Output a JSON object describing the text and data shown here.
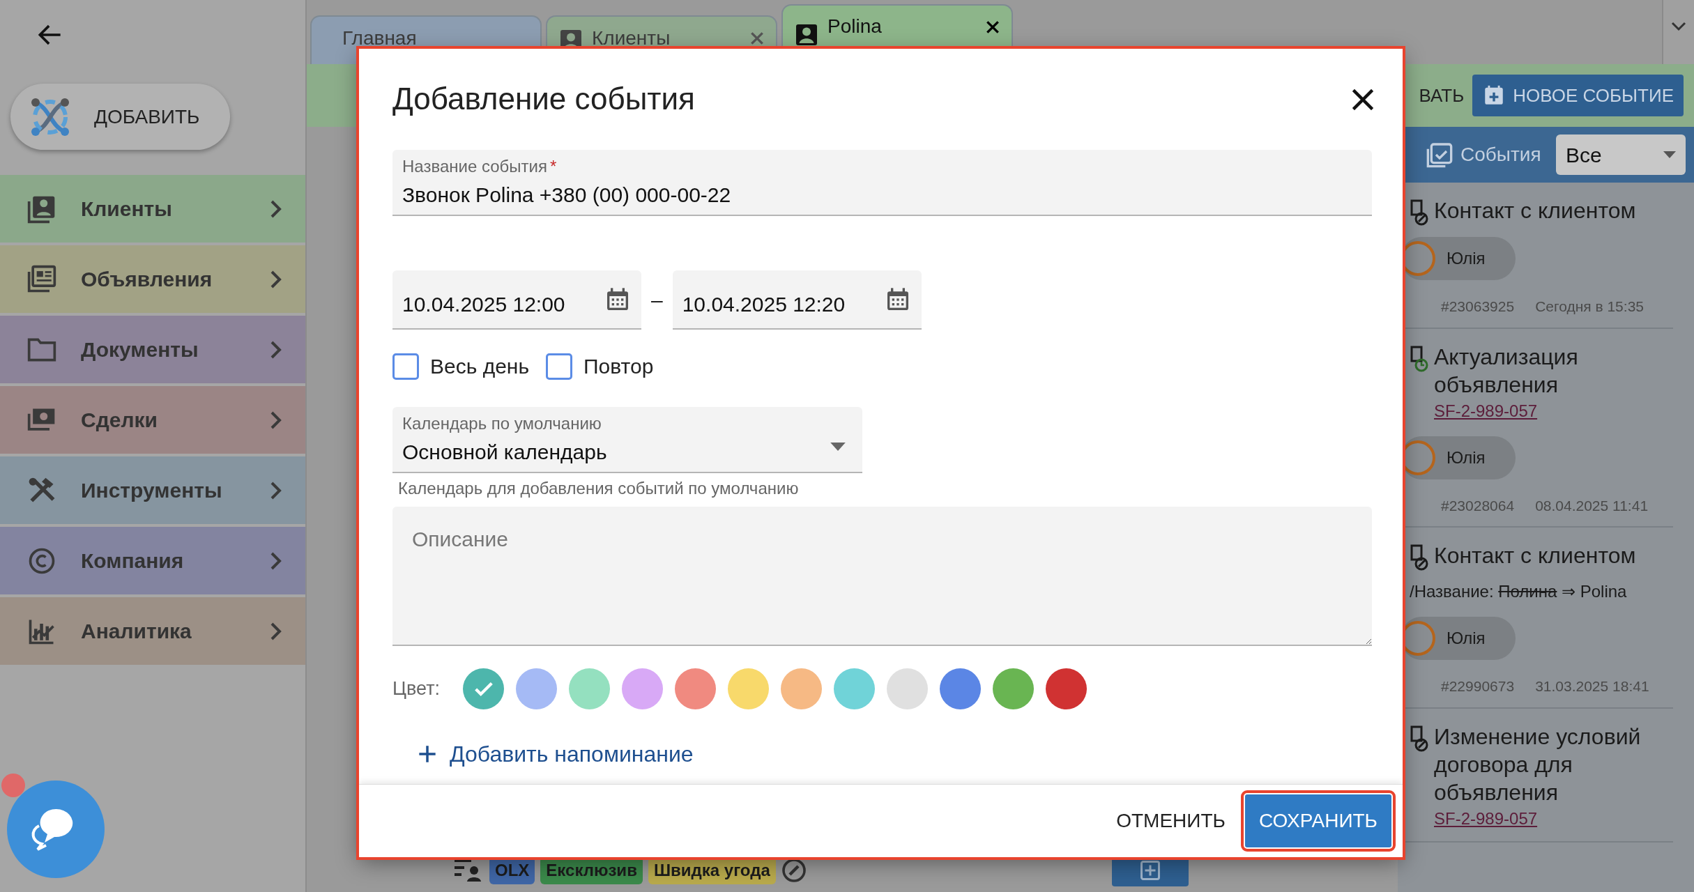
{
  "sidebar": {
    "add_button": "ДОБАВИТЬ",
    "items": [
      {
        "label": "Клиенты",
        "color": "#8ba88a"
      },
      {
        "label": "Объявления",
        "color": "#a2a285"
      },
      {
        "label": "Документы",
        "color": "#8c8399"
      },
      {
        "label": "Сделки",
        "color": "#9b8585"
      },
      {
        "label": "Инструменты",
        "color": "#8695a0"
      },
      {
        "label": "Компания",
        "color": "#8384a0"
      },
      {
        "label": "Аналитика",
        "color": "#9c9086"
      }
    ]
  },
  "tabs": [
    {
      "label": "Главная",
      "selected": false,
      "closable": false,
      "color": "#8c9db1"
    },
    {
      "label": "Клиенты",
      "selected": false,
      "closable": true,
      "color": "#8fa88e"
    },
    {
      "label": "Polina",
      "selected": true,
      "closable": true,
      "color": "#8db58a"
    }
  ],
  "toolbar": {
    "cut_text": "ВАТЬ",
    "new_event_button": "НОВОЕ СОБЫТИЕ"
  },
  "events_panel": {
    "title": "События",
    "filter": "Все",
    "events": [
      {
        "title": "Контакт с клиентом",
        "user": "Юлія",
        "id": "#23063925",
        "date": "Сегодня в 15:35"
      },
      {
        "title": "Актуализация объявления",
        "link": "SF-2-989-057",
        "user": "Юлія",
        "id": "#23028064",
        "date": "08.04.2025 11:41"
      },
      {
        "title": "Контакт с клиентом",
        "change": {
          "field": "/Название:",
          "old": "Полина",
          "arrow": "⇒",
          "new": "Polina"
        },
        "user": "Юлія",
        "id": "#22990673",
        "date": "31.03.2025 18:41"
      },
      {
        "title": "Изменение условий договора для объявления",
        "link": "SF-2-989-057"
      }
    ]
  },
  "background_tags": [
    {
      "label": "OLX",
      "color": "#3f66a6"
    },
    {
      "label": "Ексклюзив",
      "color": "#3b8a4b"
    },
    {
      "label": "Швидка угода",
      "color": "#b9aa4c"
    }
  ],
  "chat": {
    "unread": true
  },
  "dialog": {
    "title": "Добавление события",
    "highlighted": true,
    "name_field": {
      "label": "Название события",
      "required_mark": "*",
      "value": "Звонок Polina +380 (00) 000-00-22"
    },
    "start": {
      "value": "10.04.2025 12:00"
    },
    "dash": "–",
    "end": {
      "value": "10.04.2025 12:20"
    },
    "checkboxes": [
      {
        "label": "Весь день",
        "checked": false
      },
      {
        "label": "Повтор",
        "checked": false
      }
    ],
    "calendar": {
      "label": "Календарь по умолчанию",
      "value": "Основной календарь",
      "helper": "Календарь для добавления событий по умолчанию"
    },
    "description": {
      "placeholder": "Описание"
    },
    "color_label": "Цвет:",
    "colors": [
      {
        "color": "#4db6ac",
        "selected": true
      },
      {
        "color": "#a5baf5",
        "selected": false
      },
      {
        "color": "#94e0bf",
        "selected": false
      },
      {
        "color": "#d8a9f6",
        "selected": false
      },
      {
        "color": "#f08a80",
        "selected": false
      },
      {
        "color": "#f8d96b",
        "selected": false
      },
      {
        "color": "#f6b984",
        "selected": false
      },
      {
        "color": "#70d3d8",
        "selected": false
      },
      {
        "color": "#e0e0e0",
        "selected": false
      },
      {
        "color": "#5b86e5",
        "selected": false
      },
      {
        "color": "#69b552",
        "selected": false
      },
      {
        "color": "#d03232",
        "selected": false
      }
    ],
    "add_reminder": "Добавить напоминание",
    "cancel_button": "ОТМЕНИТЬ",
    "save_button": {
      "label": "СОХРАНИТЬ",
      "highlighted": true
    }
  }
}
